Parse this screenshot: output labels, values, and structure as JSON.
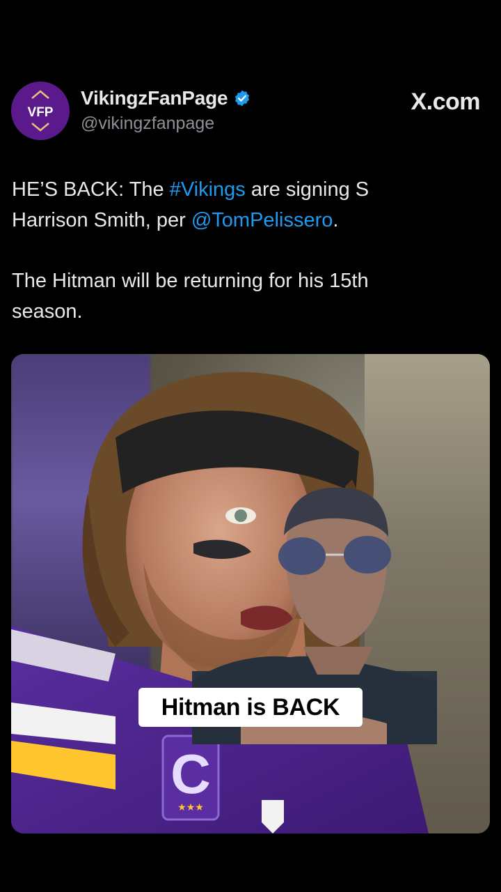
{
  "account": {
    "avatar_label": "VFP",
    "display_name": "VikingzFanPage",
    "handle": "@vikingzfanpage",
    "verified": true
  },
  "brand": {
    "site": "X.com"
  },
  "tweet": {
    "line1_before_hashtag": "HE’S BACK: The ",
    "hashtag": "#Vikings",
    "line1_after_hashtag": " are signing S",
    "line2_before_mention": "Harrison Smith, per ",
    "mention": "@TomPelissero",
    "line2_after_mention": ".",
    "paragraph2": "The Hitman will be returning for his 15th season."
  },
  "media": {
    "caption": "Hitman is BACK",
    "jersey_letter": "C"
  },
  "colors": {
    "background": "#000000",
    "link": "#1d9bf0",
    "avatar": "#5b1a8c",
    "verified_badge": "#1d9bf0",
    "jersey_purple": "#4f2683",
    "jersey_gold": "#ffc62f"
  },
  "icons": [
    "verified-badge-icon",
    "vfp-logo-icon"
  ]
}
